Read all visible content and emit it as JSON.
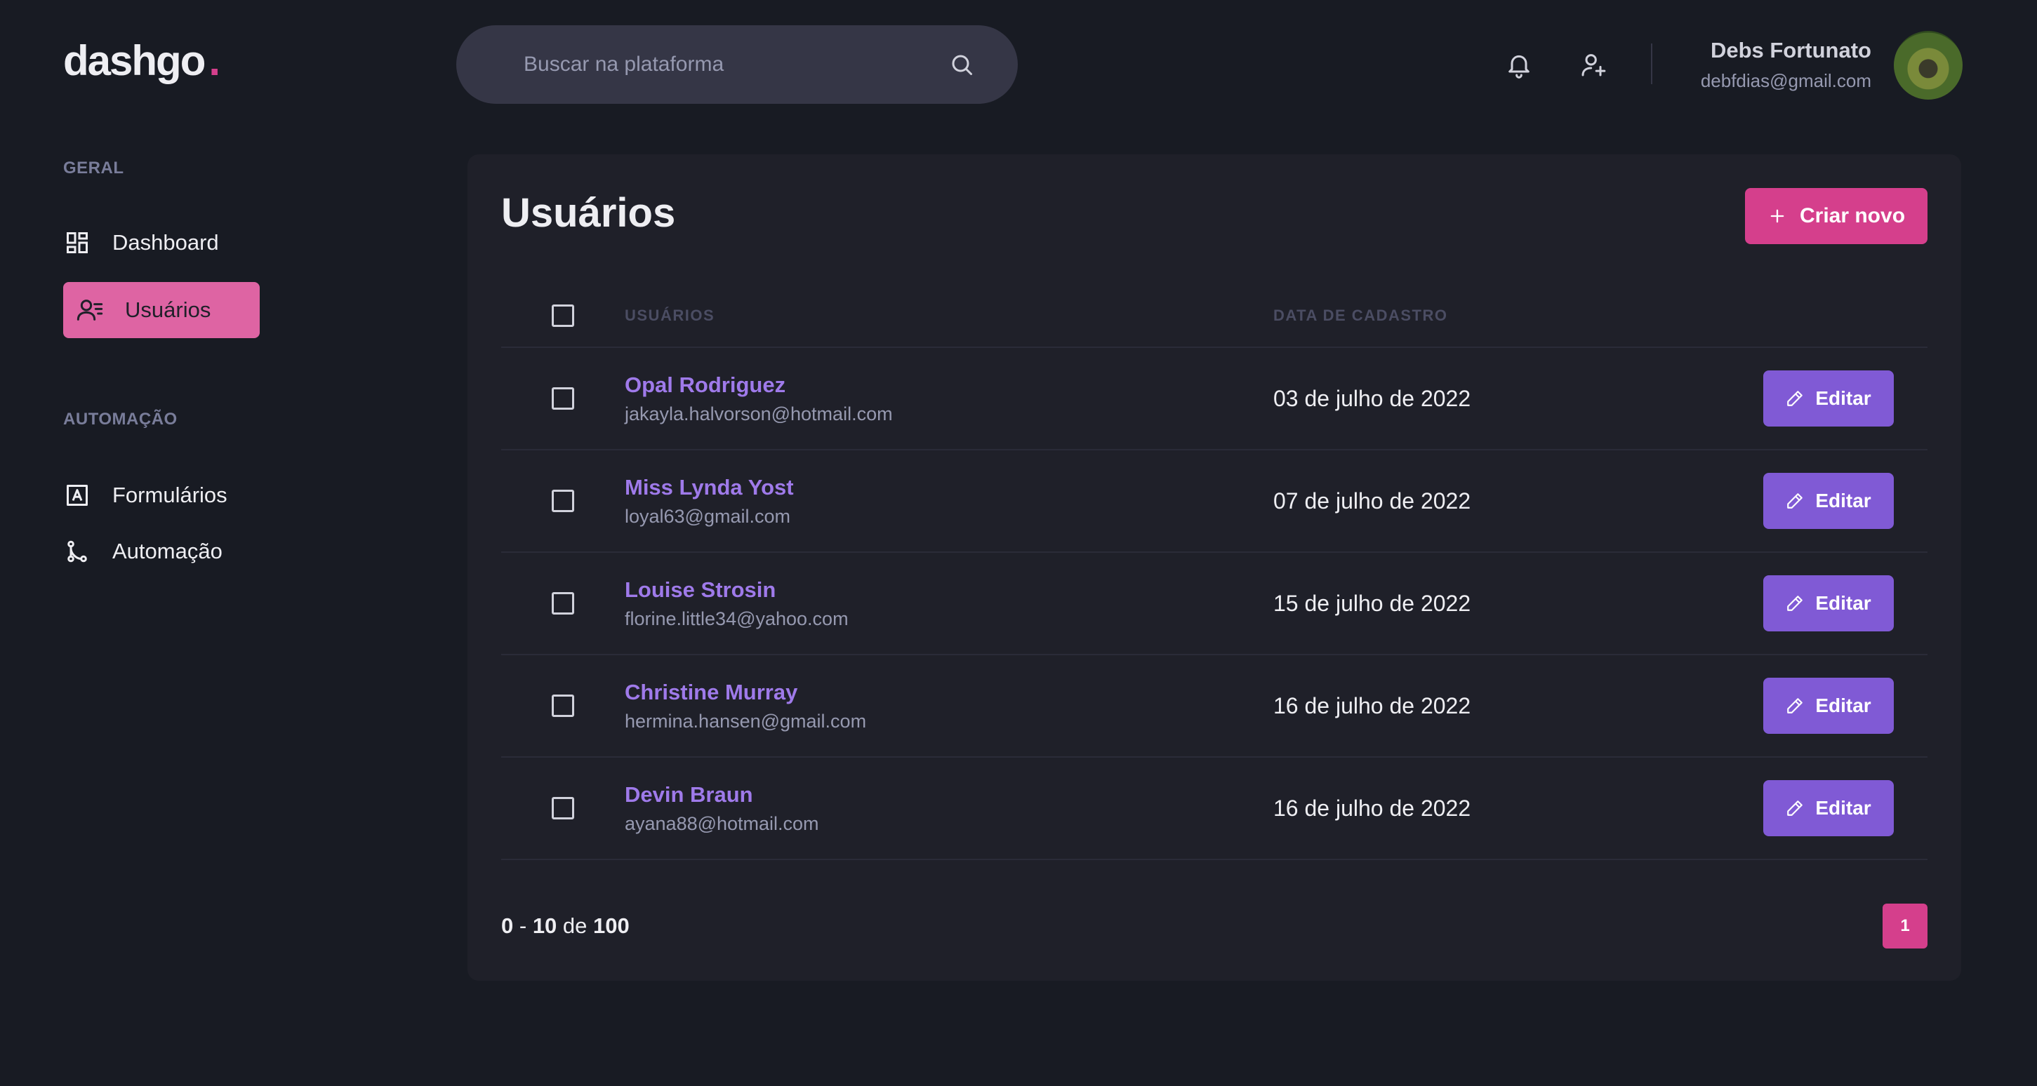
{
  "brand": {
    "logo_text": "dashgo",
    "logo_dot": ".",
    "accent": "#d53f8c"
  },
  "search": {
    "placeholder": "Buscar na plataforma",
    "value": ""
  },
  "header": {
    "notification_icon": "bell-icon",
    "add_user_icon": "user-plus-icon"
  },
  "profile": {
    "name": "Debs Fortunato",
    "email": "debfdias@gmail.com"
  },
  "sidebar": {
    "sections": [
      {
        "title": "GERAL",
        "items": [
          {
            "label": "Dashboard",
            "icon": "dashboard-icon",
            "active": false
          },
          {
            "label": "Usuários",
            "icon": "users-list-icon",
            "active": true
          }
        ]
      },
      {
        "title": "AUTOMAÇÃO",
        "items": [
          {
            "label": "Formulários",
            "icon": "form-icon",
            "active": false
          },
          {
            "label": "Automação",
            "icon": "git-merge-icon",
            "active": false
          }
        ]
      }
    ]
  },
  "main": {
    "title": "Usuários",
    "create_button": "Criar novo",
    "columns": {
      "user": "USUÁRIOS",
      "date": "DATA DE CADASTRO"
    },
    "edit_label": "Editar",
    "rows": [
      {
        "name": "Opal Rodriguez",
        "email": "jakayla.halvorson@hotmail.com",
        "date": "03 de julho de 2022"
      },
      {
        "name": "Miss Lynda Yost",
        "email": "loyal63@gmail.com",
        "date": "07 de julho de 2022"
      },
      {
        "name": "Louise Strosin",
        "email": "florine.little34@yahoo.com",
        "date": "15 de julho de 2022"
      },
      {
        "name": "Christine Murray",
        "email": "hermina.hansen@gmail.com",
        "date": "16 de julho de 2022"
      },
      {
        "name": "Devin Braun",
        "email": "ayana88@hotmail.com",
        "date": "16 de julho de 2022"
      }
    ],
    "pagination": {
      "from": "0",
      "to": "10",
      "of_label": "de",
      "total": "100",
      "current_page": "1"
    }
  },
  "colors": {
    "background": "#181b23",
    "panel": "#1f2029",
    "pink": "#d53f8c",
    "purple": "#805ad5",
    "name_purple": "#9f7aea"
  }
}
